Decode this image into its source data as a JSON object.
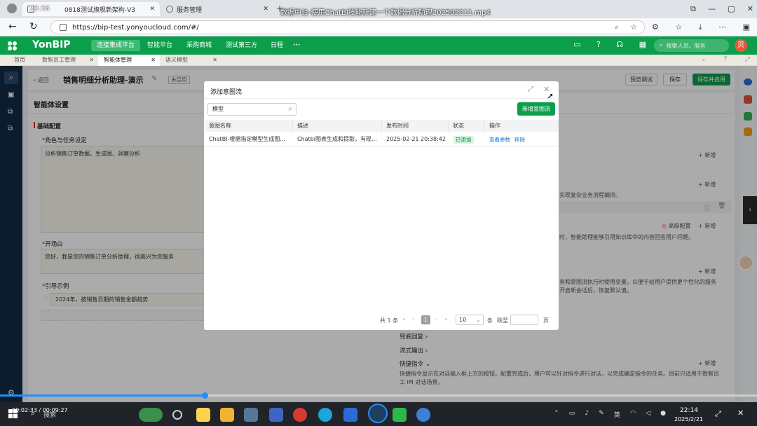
{
  "browser": {
    "window_title": "数据中台-使用ChatBI技能新建一个数据分析助理202502211.mp4",
    "tabs": [
      {
        "label": "0818测试旗舰新架构-V3"
      },
      {
        "label": "服务管理"
      }
    ],
    "clock_overlay": "23:36",
    "url": "https://bip-test.yonyoucloud.com/#/"
  },
  "app": {
    "logo": "YonBIP",
    "nav": [
      "连接集成平台",
      "智能平台",
      "采购商城",
      "测试第三方",
      "日程",
      "···"
    ],
    "search_placeholder": "搜索人员、服务",
    "avatar_text": "贝"
  },
  "page_tabs": [
    "首页",
    "数智员工管理",
    "智能体管理",
    "语义模型"
  ],
  "page": {
    "back_label": "返回",
    "title": "销售明细分析助理-演示",
    "status_tag": "未启用",
    "btn_preview": "预览调试",
    "btn_save": "保存",
    "btn_save_enable": "保存并启用",
    "panel_title": "智能体设置",
    "section_basic": "基础配置",
    "role_label": "角色与任务设定",
    "role_value": "分析销售订单数据，生成图、洞察分析",
    "opening_label": "开场白",
    "opening_value": "您好，我是您的销售订单分析助理，很高兴为您服务",
    "guide_label": "引导示例",
    "guide_value": "2024年，按销售日期的销售金额趋势",
    "add_label": "+ 新增",
    "desc_flow": "实现复杂业务流程编排。",
    "desc_kb": "时，智能助理能够引用知识库中的内容回答用户问题。",
    "adv_config": "高级配置",
    "desc_vars1": "务和意图流执行时使用变量，以便于给用户提供更个性化的服务",
    "desc_vars2": "开启新会话后，恢复默认值。",
    "fallback": "兜底回复",
    "stream_output": "流式输出",
    "shortcut": "快捷指令",
    "shortcut_desc1": "快捷指令显示在对话输入框上方的按钮。配置完成后，用户可以针对指令进行对话，以完成确定指令的任务。目前只适用于数智员",
    "shortcut_desc2": "工 IM 对话场景。"
  },
  "modal": {
    "title": "添加意图流",
    "search_value": "模型",
    "add_button": "新增意图流",
    "columns": [
      "意图名称",
      "描述",
      "发布时间",
      "状态",
      "操作"
    ],
    "rows": [
      {
        "name": "ChatBI-根据指定模型生成图...",
        "desc": "Chatbi图表生成和提取，有现...",
        "time": "2025-02-21 20:38:42",
        "status": "已添加",
        "action_view": "查看参数",
        "action_remove": "移除"
      }
    ],
    "pagination": {
      "total": "共 1 条",
      "current_page": "1",
      "page_size": "10",
      "unit": "条",
      "jump_label": "跳至",
      "page_unit": "页"
    }
  },
  "video": {
    "time": "00:02:33 / 00:09:27",
    "progress": 0.27
  },
  "taskbar": {
    "search": "搜索",
    "time": "22:14",
    "date": "2025/2/21"
  },
  "colors": {
    "brand_green": "#0b9e4b",
    "nav_dark": "#102a45",
    "link_blue": "#1677c9",
    "tag_green_bg": "#d7f2e1"
  }
}
